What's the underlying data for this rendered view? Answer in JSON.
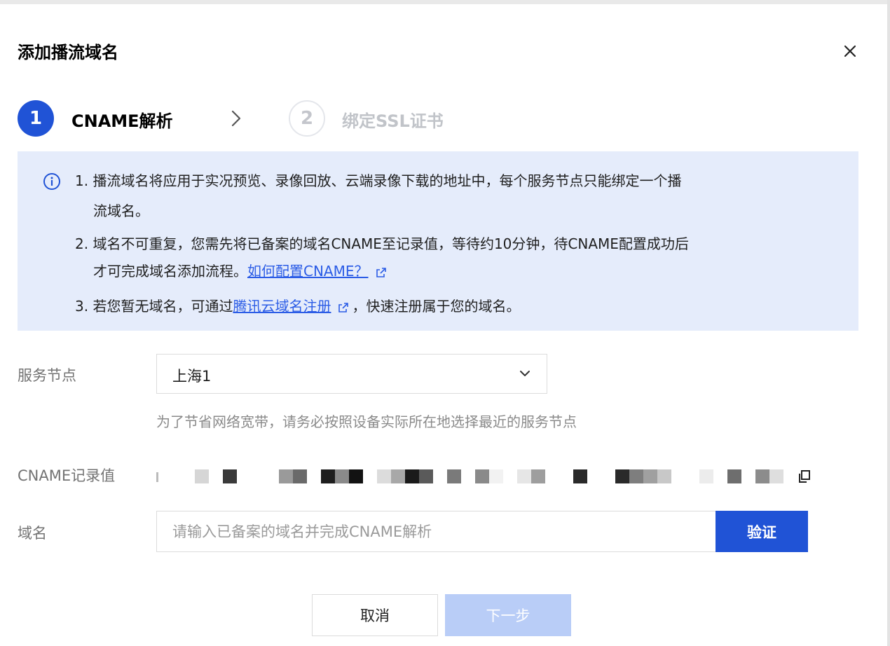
{
  "dialog": {
    "title": "添加播流域名",
    "close_icon": "close-icon"
  },
  "steps": [
    {
      "number": "1",
      "label": "CNAME解析",
      "state": "active"
    },
    {
      "number": "2",
      "label": "绑定SSL证书",
      "state": "inactive"
    }
  ],
  "notice": {
    "icon": "info-icon",
    "line1a": "1. 播流域名将应用于实况预览、录像回放、云端录像下载的地址中，每个服务节点只能绑定一个播",
    "line1b": "流域名。",
    "line2a": "2. 域名不可重复，您需先将已备案的域名CNAME至记录值，等待约10分钟，待CNAME配置成功后",
    "line2b_prefix": "才可完成域名添加流程。",
    "line2b_link": "如何配置CNAME？",
    "line3_prefix": "3. 若您暂无域名，可通过",
    "line3_link": "腾讯云域名注册",
    "line3_suffix": "，快速注册属于您的域名。"
  },
  "form": {
    "service_node": {
      "label": "服务节点",
      "value": "上海1",
      "hint": "为了节省网络宽带，请务必按照设备实际所在地选择最近的服务节点"
    },
    "cname_record": {
      "label": "CNAME记录值",
      "copy_icon": "copy-icon"
    },
    "domain": {
      "label": "域名",
      "placeholder": "请输入已备案的域名并完成CNAME解析",
      "value": "",
      "verify_label": "验证"
    }
  },
  "footer": {
    "cancel_label": "取消",
    "next_label": "下一步"
  },
  "colors": {
    "primary": "#2053d6",
    "notice_bg": "#e5ecfb",
    "link": "#2b5ce6",
    "disabled_button": "#b9cdf7"
  }
}
